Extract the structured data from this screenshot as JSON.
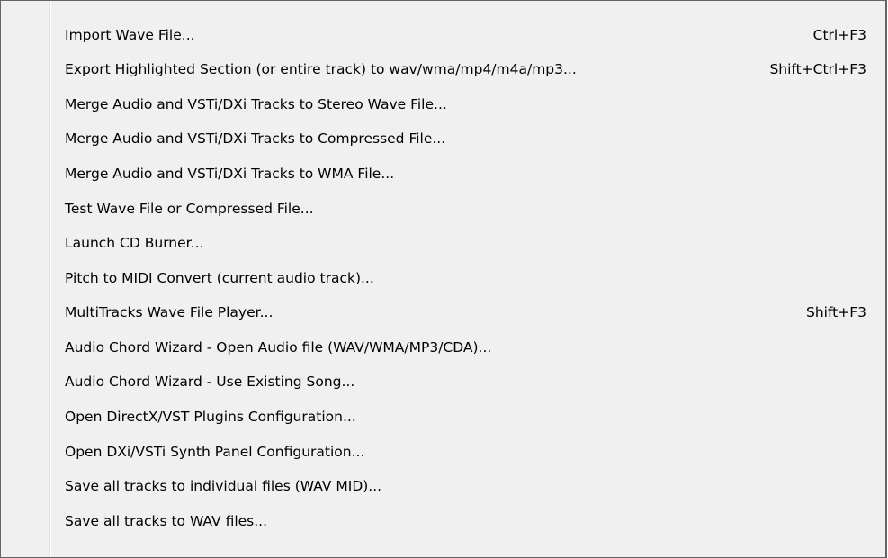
{
  "menu": {
    "items": [
      {
        "label": "Import Wave File...",
        "shortcut": "Ctrl+F3"
      },
      {
        "label": "Export Highlighted Section (or entire track) to wav/wma/mp4/m4a/mp3...",
        "shortcut": "Shift+Ctrl+F3"
      },
      {
        "label": "Merge Audio and VSTi/DXi Tracks to Stereo Wave File...",
        "shortcut": ""
      },
      {
        "label": "Merge Audio and VSTi/DXi Tracks to Compressed File...",
        "shortcut": ""
      },
      {
        "label": "Merge Audio and VSTi/DXi Tracks to WMA File...",
        "shortcut": ""
      },
      {
        "label": "Test Wave File or Compressed File...",
        "shortcut": ""
      },
      {
        "label": "Launch CD Burner...",
        "shortcut": ""
      },
      {
        "label": "Pitch to MIDI Convert (current audio track)...",
        "shortcut": ""
      },
      {
        "label": "MultiTracks Wave File Player...",
        "shortcut": "Shift+F3"
      },
      {
        "label": "Audio Chord Wizard - Open Audio file (WAV/WMA/MP3/CDA)...",
        "shortcut": ""
      },
      {
        "label": "Audio Chord Wizard -  Use Existing Song...",
        "shortcut": ""
      },
      {
        "label": "Open DirectX/VST Plugins Configuration...",
        "shortcut": ""
      },
      {
        "label": "Open DXi/VSTi Synth Panel Configuration...",
        "shortcut": ""
      },
      {
        "label": "Save all tracks to individual files (WAV  MID)...",
        "shortcut": ""
      },
      {
        "label": "Save all tracks to WAV files...",
        "shortcut": ""
      }
    ]
  }
}
